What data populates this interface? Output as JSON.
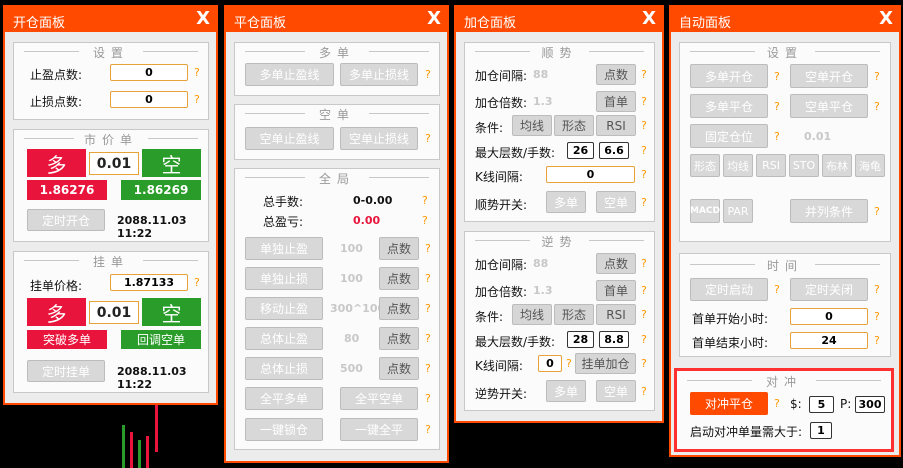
{
  "colors": {
    "accent": "#ff4a00",
    "buy": "#e8143c",
    "sell": "#2a9c2a",
    "question": "#ff9900"
  },
  "close_symbol": "X",
  "help_symbol": "?",
  "open_panel": {
    "title": "开仓面板",
    "settings": {
      "title": "设置",
      "tp_label": "止盈点数:",
      "tp_value": "0",
      "sl_label": "止损点数:",
      "sl_value": "0"
    },
    "market": {
      "title": "市价单",
      "buy_label": "多",
      "lot": "0.01",
      "sell_label": "空",
      "buy_price": "1.86276",
      "sell_price": "1.86269",
      "timer_button": "定时开仓",
      "datetime": "2088.11.03 11:22"
    },
    "pending": {
      "title": "挂单",
      "price_label": "挂单价格:",
      "price_value": "1.87133",
      "buy_label": "多",
      "lot": "0.01",
      "sell_label": "空",
      "breakout_buy": "突破多单",
      "pullback_sell": "回调空单",
      "timer_button": "定时挂单",
      "datetime": "2088.11.03 11:22"
    }
  },
  "close_panel": {
    "title": "平仓面板",
    "long": {
      "title": "多单",
      "tp_button": "多单止盈线",
      "sl_button": "多单止损线"
    },
    "short": {
      "title": "空单",
      "tp_button": "空单止盈线",
      "sl_button": "空单止损线"
    },
    "global": {
      "title": "全局",
      "total_lots_label": "总手数:",
      "total_lots_value": "0-0.00",
      "total_pl_label": "总盈亏:",
      "total_pl_value": "0.00",
      "rows": [
        {
          "button": "单独止盈",
          "value": "100",
          "unit": "点数"
        },
        {
          "button": "单独止损",
          "value": "100",
          "unit": "点数"
        },
        {
          "button": "移动止盈",
          "value": "300^100",
          "unit": "点数"
        },
        {
          "button": "总体止盈",
          "value": "80",
          "unit": "点数"
        },
        {
          "button": "总体止损",
          "value": "500",
          "unit": "点数"
        }
      ],
      "close_long": "全平多单",
      "close_short": "全平空单",
      "lock": "一键锁仓",
      "close_all": "一键全平"
    }
  },
  "add_panel": {
    "title": "加仓面板",
    "trend": {
      "title": "顺势",
      "interval_label": "加仓间隔:",
      "interval_value": "88",
      "interval_unit": "点数",
      "mult_label": "加仓倍数:",
      "mult_value": "1.3",
      "mult_unit": "首单",
      "cond_label": "条件:",
      "cond_buttons": [
        "均线",
        "形态",
        "RSI"
      ],
      "max_label": "最大层数/手数:",
      "max_layers": "26",
      "max_lots": "6.6",
      "k_label": "K线间隔:",
      "k_value": "0",
      "switch_label": "顺势开关:",
      "switch_long": "多单",
      "switch_short": "空单"
    },
    "counter": {
      "title": "逆势",
      "interval_label": "加仓间隔:",
      "interval_value": "88",
      "interval_unit": "点数",
      "mult_label": "加仓倍数:",
      "mult_value": "1.3",
      "mult_unit": "首单",
      "cond_label": "条件:",
      "cond_buttons": [
        "均线",
        "形态",
        "RSI"
      ],
      "max_label": "最大层数/手数:",
      "max_layers": "28",
      "max_lots": "8.8",
      "k_label": "K线间隔:",
      "k_value": "0",
      "pending_add": "挂单加仓",
      "switch_label": "逆势开关:",
      "switch_long": "多单",
      "switch_short": "空单"
    }
  },
  "auto_panel": {
    "title": "自动面板",
    "settings": {
      "title": "设置",
      "long_open": "多单开仓",
      "short_open": "空单开仓",
      "long_close": "多单平仓",
      "short_close": "空单平仓",
      "fixed_pos": "固定仓位",
      "fixed_value": "0.01",
      "indicators": [
        "形态",
        "均线",
        "RSI",
        "STO",
        "布林",
        "海龟"
      ],
      "macd": "MACD",
      "par": "PAR",
      "parallel": "并列条件"
    },
    "time": {
      "title": "时间",
      "timer_start": "定时启动",
      "timer_stop": "定时关闭",
      "first_start_label": "首单开始小时:",
      "first_start_value": "0",
      "first_end_label": "首单结束小时:",
      "first_end_value": "24"
    },
    "hedge": {
      "title": "对冲",
      "hedge_close": "对冲平仓",
      "dollar_label": "$:",
      "dollar_value": "5",
      "p_label": "P:",
      "p_value": "300",
      "trigger_label": "启动对冲单量需大于:",
      "trigger_value": "1"
    }
  }
}
